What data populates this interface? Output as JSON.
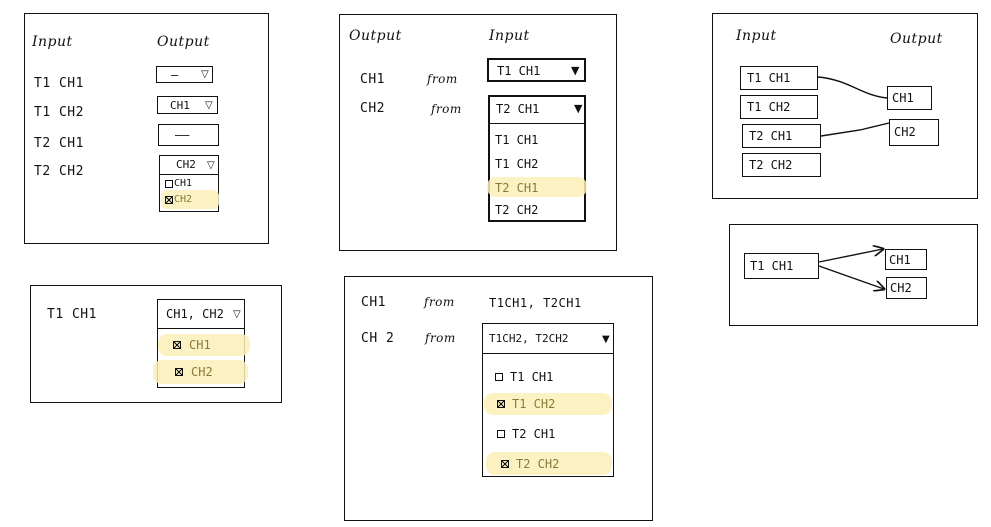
{
  "sketch1": {
    "input_header": "Input",
    "output_header": "Output",
    "rows": [
      "T1  CH1",
      "T1  CH2",
      "T2  CH1",
      "T2  CH2"
    ],
    "row1_value": "—",
    "row2_value": "CH1",
    "row3_value": "——",
    "row4_value": "CH2",
    "options": [
      "CH1",
      "CH2"
    ]
  },
  "sketch2": {
    "input_label": "T1  CH1",
    "selected": "CH1, CH2",
    "options": [
      "CH1",
      "CH2"
    ]
  },
  "sketch3": {
    "output_header": "Output",
    "input_header": "Input",
    "rows": [
      {
        "channel": "CH1",
        "from": "from",
        "value": "T1  CH1"
      },
      {
        "channel": "CH2",
        "from": "from",
        "value": "T2  CH1"
      }
    ],
    "options": [
      "T1   CH1",
      "T1   CH2",
      "T2   CH1",
      "T2   CH2"
    ]
  },
  "sketch4": {
    "rows": [
      {
        "channel": "CH1",
        "from": "from",
        "value": "T1CH1, T2CH1"
      },
      {
        "channel": "CH 2",
        "from": "from",
        "value": "T1CH2, T2CH2"
      }
    ],
    "options": [
      "T1  CH1",
      "T1  CH2",
      "T2  CH1",
      "T2  CH2"
    ]
  },
  "sketch5": {
    "input_header": "Input",
    "output_header": "Output",
    "inputs": [
      "T1  CH1",
      "T1  CH2",
      "T2  CH1",
      "T2  CH2"
    ],
    "outputs": [
      "CH1",
      "CH2"
    ]
  },
  "sketch6": {
    "input": "T1  CH1",
    "outputs": [
      "CH1",
      "CH2"
    ]
  }
}
